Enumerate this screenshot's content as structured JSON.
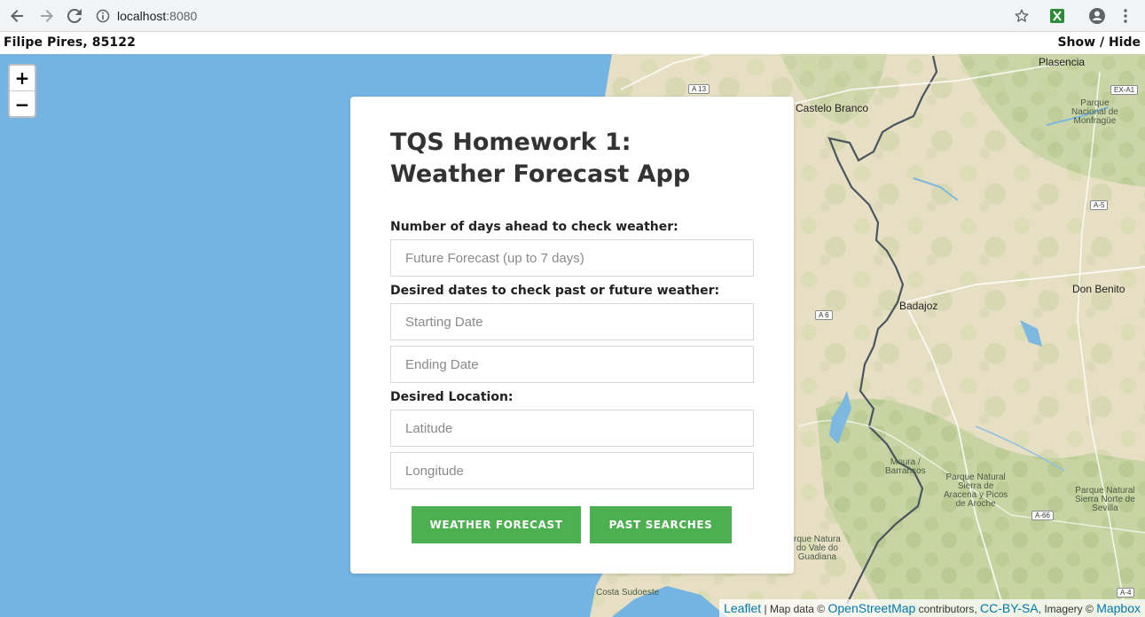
{
  "browser": {
    "url_host": "localhost",
    "url_port": ":8080"
  },
  "header": {
    "author": "Filipe Pires, 85122",
    "show_label": "Show",
    "separator": "/",
    "hide_label": "Hide"
  },
  "map": {
    "zoom_in": "+",
    "zoom_out": "−",
    "cities": {
      "plasencia": "Plasencia",
      "castelo_branco": "Castelo Branco",
      "badajoz": "Badajoz",
      "don_benito": "Don Benito",
      "moura": "Moura /",
      "barrancos": "Barrancos",
      "costa_sudoeste": "Costa Sudoeste"
    },
    "parks": {
      "monfrague": [
        "Parque",
        "Nacional de",
        "Monfragüe"
      ],
      "aracena": [
        "Parque Natural",
        "Sierra de",
        "Aracena y Picos",
        "de Aroche"
      ],
      "sierra_norte": [
        "Parque Natural",
        "Sierra Norte de",
        "Sevilla"
      ],
      "guadiana": [
        "rque Natura",
        "do Vale do",
        "Guadiana"
      ]
    },
    "roads": {
      "a13": "A 13",
      "exa1": "EX-A1",
      "a5": "A-5",
      "a6": "A 6",
      "a66": "A-66",
      "a4": "A-4"
    },
    "attribution": {
      "leaflet": "Leaflet",
      "sep1": " | Map data © ",
      "osm": "OpenStreetMap",
      "contrib": " contributors, ",
      "ccbysa": "CC-BY-SA",
      "imagery": ", Imagery © ",
      "mapbox": "Mapbox"
    }
  },
  "form": {
    "title_line1": "TQS Homework 1:",
    "title_line2": "Weather Forecast App",
    "days_label": "Number of days ahead to check weather:",
    "days_placeholder": "Future Forecast (up to 7 days)",
    "dates_label": "Desired dates to check past or future weather:",
    "start_placeholder": "Starting Date",
    "end_placeholder": "Ending Date",
    "location_label": "Desired Location:",
    "lat_placeholder": "Latitude",
    "lon_placeholder": "Longitude",
    "forecast_button": "WEATHER FORECAST",
    "past_button": "PAST SEARCHES"
  }
}
